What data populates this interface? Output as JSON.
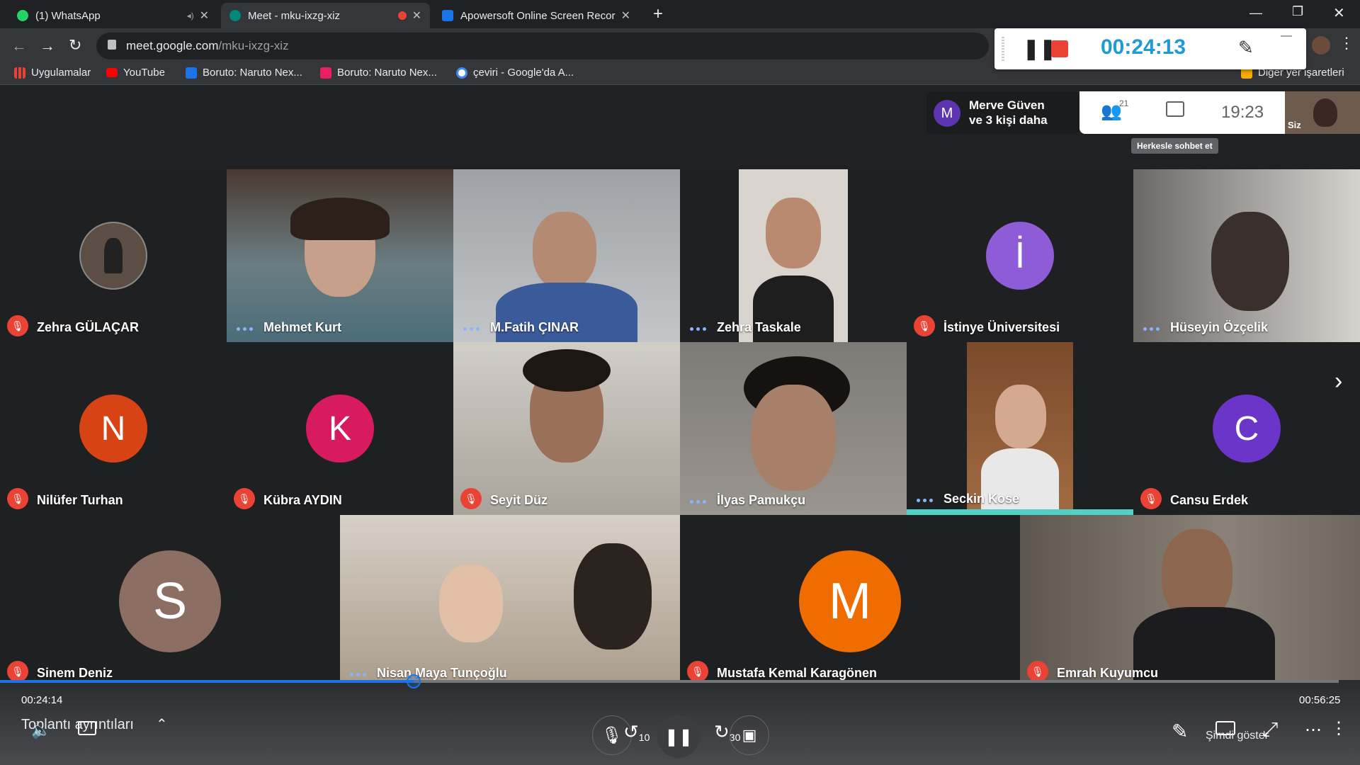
{
  "tabs": [
    {
      "title": "(1) WhatsApp",
      "favicon_color": "#25d366",
      "active": false
    },
    {
      "title": "Meet - mku-ixzg-xiz",
      "favicon_color": "#00897b",
      "active": true
    },
    {
      "title": "Apowersoft Online Screen Recor",
      "favicon_color": "#1a73e8",
      "active": false
    }
  ],
  "address": {
    "domain": "meet.google.com",
    "path": "/mku-ixzg-xiz"
  },
  "bookmarks": [
    {
      "label": "Uygulamalar",
      "icon_color": "#ea4335"
    },
    {
      "label": "YouTube",
      "icon_color": "#ff0000"
    },
    {
      "label": "Boruto: Naruto Nex...",
      "icon_color": "#1a73e8"
    },
    {
      "label": "Boruto: Naruto Nex...",
      "icon_color": "#e91e63"
    },
    {
      "label": "çeviri - Google'da A...",
      "icon_color": "#4285f4"
    }
  ],
  "bookmarks_other": "Diğer yer işaretleri",
  "recorder": {
    "elapsed": "00:24:13",
    "minimize": "—"
  },
  "meet_header": {
    "presenter_initial": "M",
    "presenter_line1": "Merve Güven",
    "presenter_line2": "ve 3 kişi daha",
    "participant_count": "21",
    "clock": "19:23",
    "self_label": "Siz",
    "tooltip": "Herkesle sohbet et"
  },
  "participants": [
    {
      "name": "Zehra GÜLAÇAR",
      "status": "muted",
      "kind": "photo-avatar",
      "color": "#5d4e45"
    },
    {
      "name": "Mehmet Kurt",
      "status": "dots",
      "kind": "video",
      "color": "#5a6a70"
    },
    {
      "name": "M.Fatih ÇINAR",
      "status": "dots",
      "kind": "video",
      "color": "#8a8f95"
    },
    {
      "name": "Zehra Taskale",
      "status": "dots",
      "kind": "video",
      "color": "#c9c2bb"
    },
    {
      "name": "İstinye Üniversitesi",
      "status": "muted",
      "kind": "avatar",
      "initial": "İ",
      "color": "#8e5cd6"
    },
    {
      "name": "Hüseyin Özçelik",
      "status": "dots",
      "kind": "video",
      "color": "#6f6a66"
    },
    {
      "name": "Nilüfer Turhan",
      "status": "muted",
      "kind": "avatar",
      "initial": "N",
      "color": "#d84315"
    },
    {
      "name": "Kübra AYDIN",
      "status": "muted",
      "kind": "avatar",
      "initial": "K",
      "color": "#d81b60"
    },
    {
      "name": "Seyit Düz",
      "status": "muted",
      "kind": "video",
      "color": "#7a7570"
    },
    {
      "name": "İlyas Pamukçu",
      "status": "dots",
      "kind": "video",
      "color": "#8a8580"
    },
    {
      "name": "Seckin Kose",
      "status": "dots",
      "kind": "video",
      "color": "#8b5a35"
    },
    {
      "name": "Cansu Erdek",
      "status": "muted",
      "kind": "avatar",
      "initial": "C",
      "color": "#6a35c8"
    },
    {
      "name": "Sinem Deniz",
      "status": "muted",
      "kind": "avatar",
      "initial": "S",
      "color": "#8d6e63"
    },
    {
      "name": "Nisan Maya Tunçoğlu",
      "status": "dots",
      "kind": "video",
      "color": "#b5a898"
    },
    {
      "name": "Mustafa Kemal Karagönen",
      "status": "muted",
      "kind": "avatar",
      "initial": "M",
      "color": "#ef6c00"
    },
    {
      "name": "Emrah Kuyumcu",
      "status": "muted",
      "kind": "video",
      "color": "#7e776f"
    }
  ],
  "player": {
    "current_time": "00:24:14",
    "total_time": "00:56:25",
    "progress_fraction": 0.309,
    "meeting_details": "Toplantı ayrıntıları",
    "skip_back": "10",
    "skip_forward": "30",
    "present_label": "Şimdi göster"
  },
  "colors": {
    "accent": "#1a73e8",
    "active_speaker": "#4fd1c5",
    "mute_red": "#ea4335",
    "record_red": "#ea4335"
  }
}
